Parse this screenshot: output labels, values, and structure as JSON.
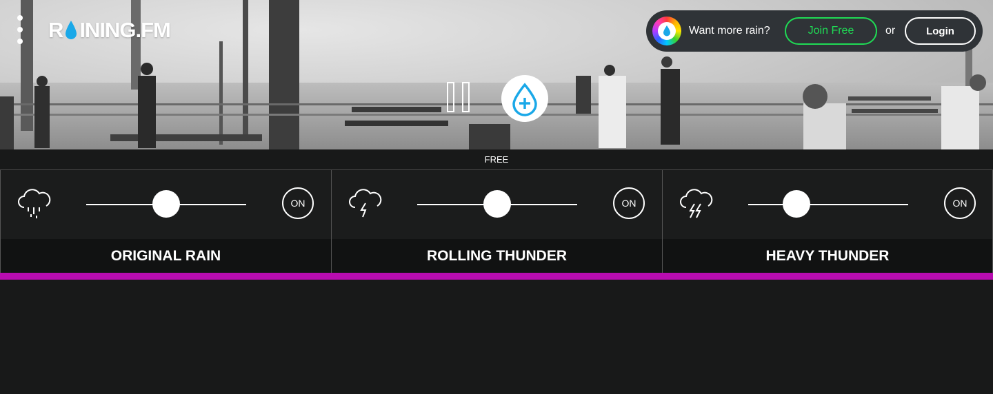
{
  "brand": {
    "logo_text_1": "R",
    "logo_text_2": "INING.FM"
  },
  "account": {
    "prompt": "Want more rain?",
    "join_label": "Join Free",
    "or_label": "or",
    "login_label": "Login"
  },
  "tier_label": "FREE",
  "mixer": {
    "channels": [
      {
        "name": "ORIGINAL RAIN",
        "toggle_label": "ON",
        "volume": 0.5,
        "icon": "rain-cloud-icon"
      },
      {
        "name": "ROLLING THUNDER",
        "toggle_label": "ON",
        "volume": 0.5,
        "icon": "thunder-cloud-icon"
      },
      {
        "name": "HEAVY THUNDER",
        "toggle_label": "ON",
        "volume": 0.3,
        "icon": "heavy-thunder-cloud-icon"
      }
    ]
  },
  "colors": {
    "accent": "#b80cb0",
    "join_green": "#1fdd55",
    "drop_blue": "#1aa8e8"
  }
}
